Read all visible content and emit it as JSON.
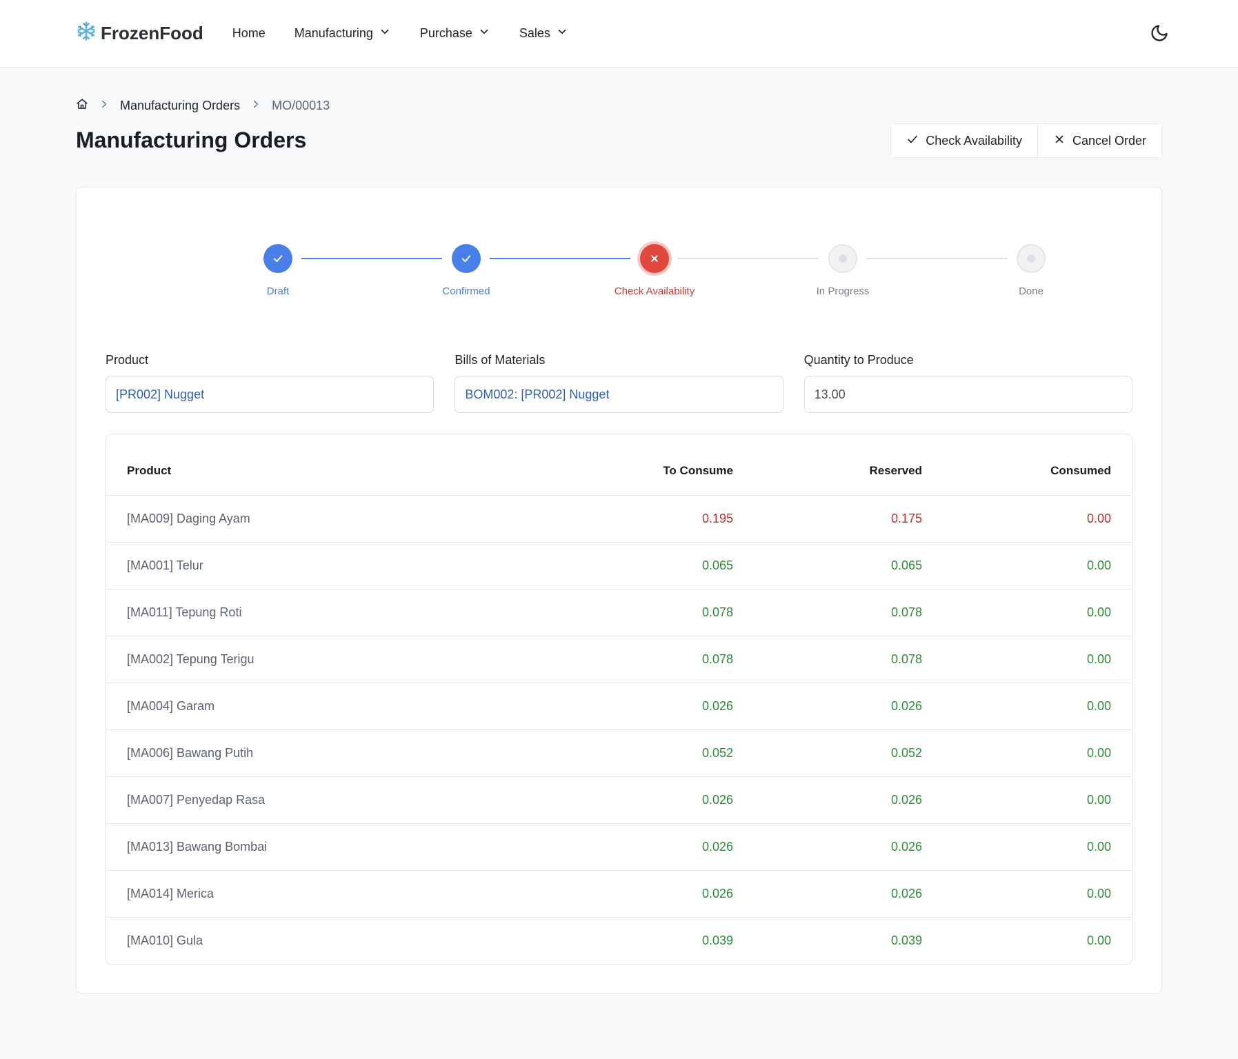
{
  "brand": {
    "name": "FrozenFood",
    "icon": "snowflake-icon"
  },
  "nav": {
    "home": "Home",
    "manufacturing": "Manufacturing",
    "purchase": "Purchase",
    "sales": "Sales"
  },
  "breadcrumb": {
    "items": [
      "Manufacturing Orders",
      "MO/00013"
    ]
  },
  "page": {
    "title": "Manufacturing Orders"
  },
  "actions": {
    "check_availability": "Check Availability",
    "cancel_order": "Cancel Order"
  },
  "stepper": {
    "steps": [
      {
        "label": "Draft",
        "state": "done"
      },
      {
        "label": "Confirmed",
        "state": "done"
      },
      {
        "label": "Check Availability",
        "state": "error"
      },
      {
        "label": "In Progress",
        "state": "pending"
      },
      {
        "label": "Done",
        "state": "pending"
      }
    ]
  },
  "form": {
    "product_label": "Product",
    "product_value": "[PR002] Nugget",
    "bom_label": "Bills of Materials",
    "bom_value": "BOM002: [PR002] Nugget",
    "qty_label": "Quantity to Produce",
    "qty_value": "13.00"
  },
  "table": {
    "headers": {
      "product": "Product",
      "to_consume": "To Consume",
      "reserved": "Reserved",
      "consumed": "Consumed"
    },
    "rows": [
      {
        "product": "[MA009] Daging Ayam",
        "to_consume": "0.195",
        "reserved": "0.175",
        "consumed": "0.00",
        "status": "red"
      },
      {
        "product": "[MA001] Telur",
        "to_consume": "0.065",
        "reserved": "0.065",
        "consumed": "0.00",
        "status": "green"
      },
      {
        "product": "[MA011] Tepung Roti",
        "to_consume": "0.078",
        "reserved": "0.078",
        "consumed": "0.00",
        "status": "green"
      },
      {
        "product": "[MA002] Tepung Terigu",
        "to_consume": "0.078",
        "reserved": "0.078",
        "consumed": "0.00",
        "status": "green"
      },
      {
        "product": "[MA004] Garam",
        "to_consume": "0.026",
        "reserved": "0.026",
        "consumed": "0.00",
        "status": "green"
      },
      {
        "product": "[MA006] Bawang Putih",
        "to_consume": "0.052",
        "reserved": "0.052",
        "consumed": "0.00",
        "status": "green"
      },
      {
        "product": "[MA007] Penyedap Rasa",
        "to_consume": "0.026",
        "reserved": "0.026",
        "consumed": "0.00",
        "status": "green"
      },
      {
        "product": "[MA013] Bawang Bombai",
        "to_consume": "0.026",
        "reserved": "0.026",
        "consumed": "0.00",
        "status": "green"
      },
      {
        "product": "[MA014] Merica",
        "to_consume": "0.026",
        "reserved": "0.026",
        "consumed": "0.00",
        "status": "green"
      },
      {
        "product": "[MA010] Gula",
        "to_consume": "0.039",
        "reserved": "0.039",
        "consumed": "0.00",
        "status": "green"
      }
    ]
  },
  "colors": {
    "accent": "#4a7ee8",
    "error": "#e0483e",
    "shortage_text": "#b9312a",
    "available_text": "#2f8a3a",
    "link": "#2f5eb5"
  }
}
